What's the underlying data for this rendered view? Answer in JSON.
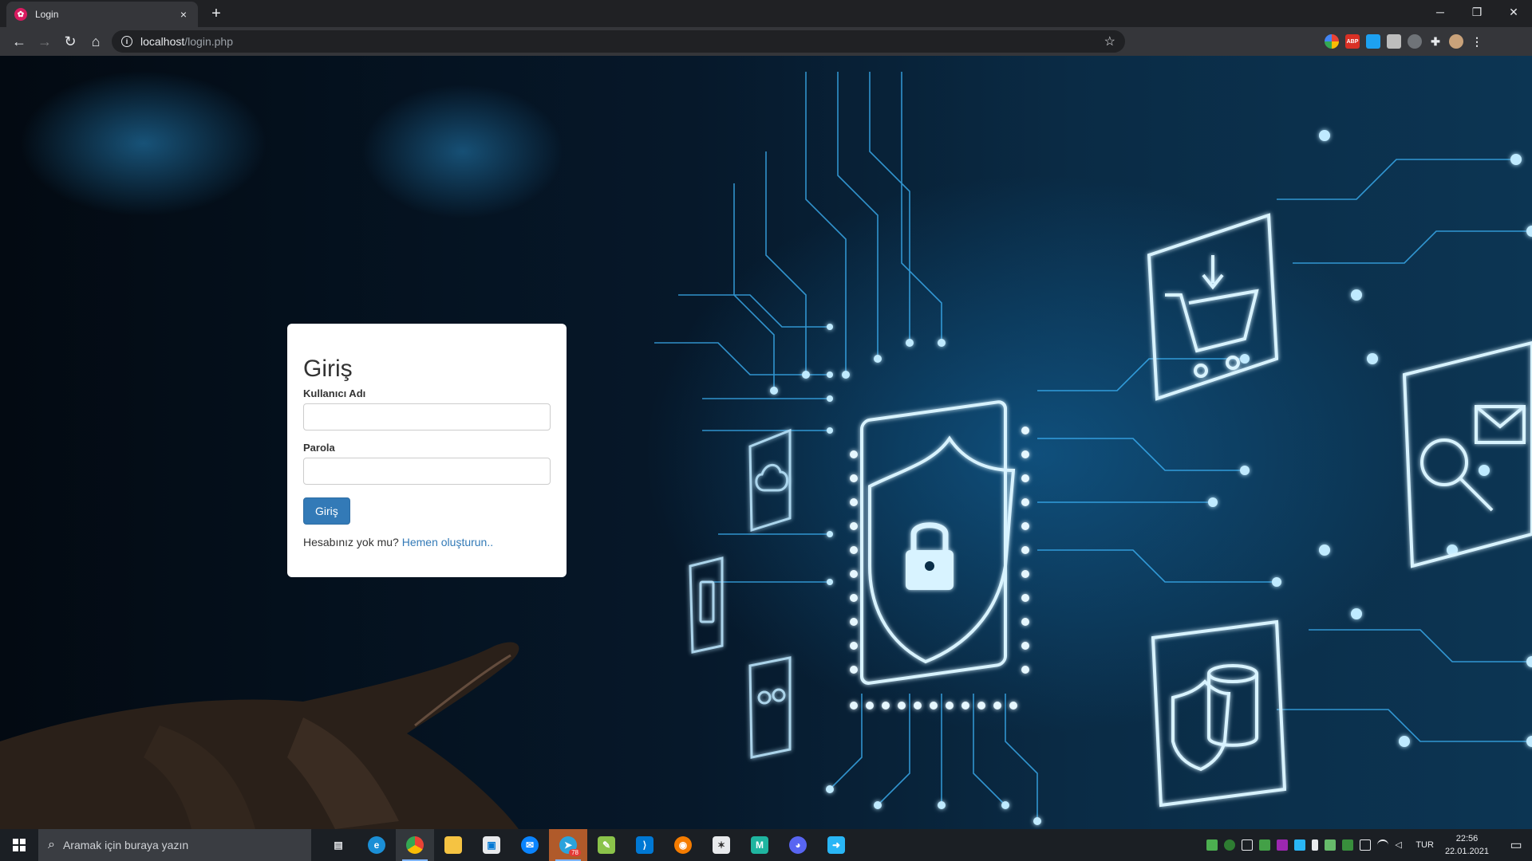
{
  "browser": {
    "tab_title": "Login",
    "url_host": "localhost",
    "url_path": "/login.php",
    "new_tab_label": "+",
    "tab_close_label": "×"
  },
  "login": {
    "title": "Giriş",
    "username_label": "Kullanıcı Adı",
    "username_value": "",
    "password_label": "Parola",
    "password_value": "",
    "submit_label": "Giriş",
    "no_account_text": "Hesabınız yok mu?",
    "signup_link": "Hemen oluşturun.."
  },
  "taskbar": {
    "search_placeholder": "Aramak için buraya yazın",
    "language": "TUR",
    "time": "22:56",
    "date": "22.01.2021",
    "telegram_badge": "78"
  },
  "colors": {
    "primary_button": "#337ab7",
    "link": "#337ab7",
    "chrome_dark": "#202124",
    "chrome_toolbar": "#35363a"
  }
}
